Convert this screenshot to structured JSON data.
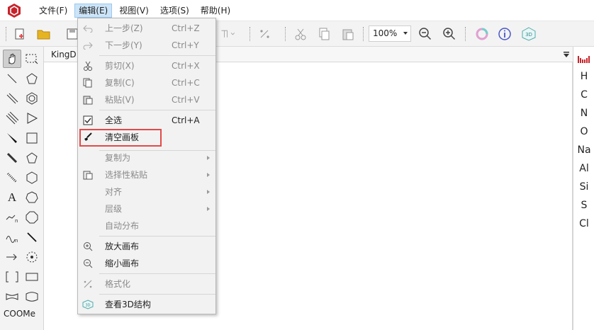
{
  "menubar": {
    "items": [
      {
        "label": "文件(F)",
        "active": false
      },
      {
        "label": "编辑(E)",
        "active": true
      },
      {
        "label": "视图(V)",
        "active": false
      },
      {
        "label": "选项(S)",
        "active": false
      },
      {
        "label": "帮助(H)",
        "active": false
      }
    ]
  },
  "toolbar": {
    "zoom_value": "100%",
    "icons": [
      "new-document-icon",
      "open-folder-icon",
      "save-icon",
      "cut-icon",
      "copy-icon",
      "paste-icon",
      "zoom-out-icon",
      "zoom-in-icon",
      "color-ring-icon",
      "info-icon",
      "3d-view-icon"
    ]
  },
  "palette": {
    "text_tool_label": "A",
    "coome_label": "COOMe"
  },
  "canvas": {
    "tab_label": "KingD"
  },
  "elements": [
    "H",
    "C",
    "N",
    "O",
    "Na",
    "Al",
    "Si",
    "S",
    "Cl"
  ],
  "edit_menu": {
    "undo": {
      "label": "上一步(Z)",
      "shortcut": "Ctrl+Z"
    },
    "redo": {
      "label": "下一步(Y)",
      "shortcut": "Ctrl+Y"
    },
    "cut": {
      "label": "剪切(X)",
      "shortcut": "Ctrl+X"
    },
    "copy": {
      "label": "复制(C)",
      "shortcut": "Ctrl+C"
    },
    "paste": {
      "label": "粘贴(V)",
      "shortcut": "Ctrl+V"
    },
    "select_all": {
      "label": "全选",
      "shortcut": "Ctrl+A"
    },
    "clear_canvas": {
      "label": "清空画板"
    },
    "copy_as": {
      "label": "复制为"
    },
    "paste_special": {
      "label": "选择性粘贴"
    },
    "align": {
      "label": "对齐"
    },
    "layer": {
      "label": "层级"
    },
    "auto_distribute": {
      "label": "自动分布"
    },
    "zoom_in": {
      "label": "放大画布"
    },
    "zoom_out": {
      "label": "缩小画布"
    },
    "format": {
      "label": "格式化"
    },
    "view_3d": {
      "label": "查看3D结构"
    }
  },
  "colors": {
    "highlight_box": "#e34a4a",
    "menu_active_bg": "#cce4f7",
    "logo_red": "#c8232b"
  }
}
